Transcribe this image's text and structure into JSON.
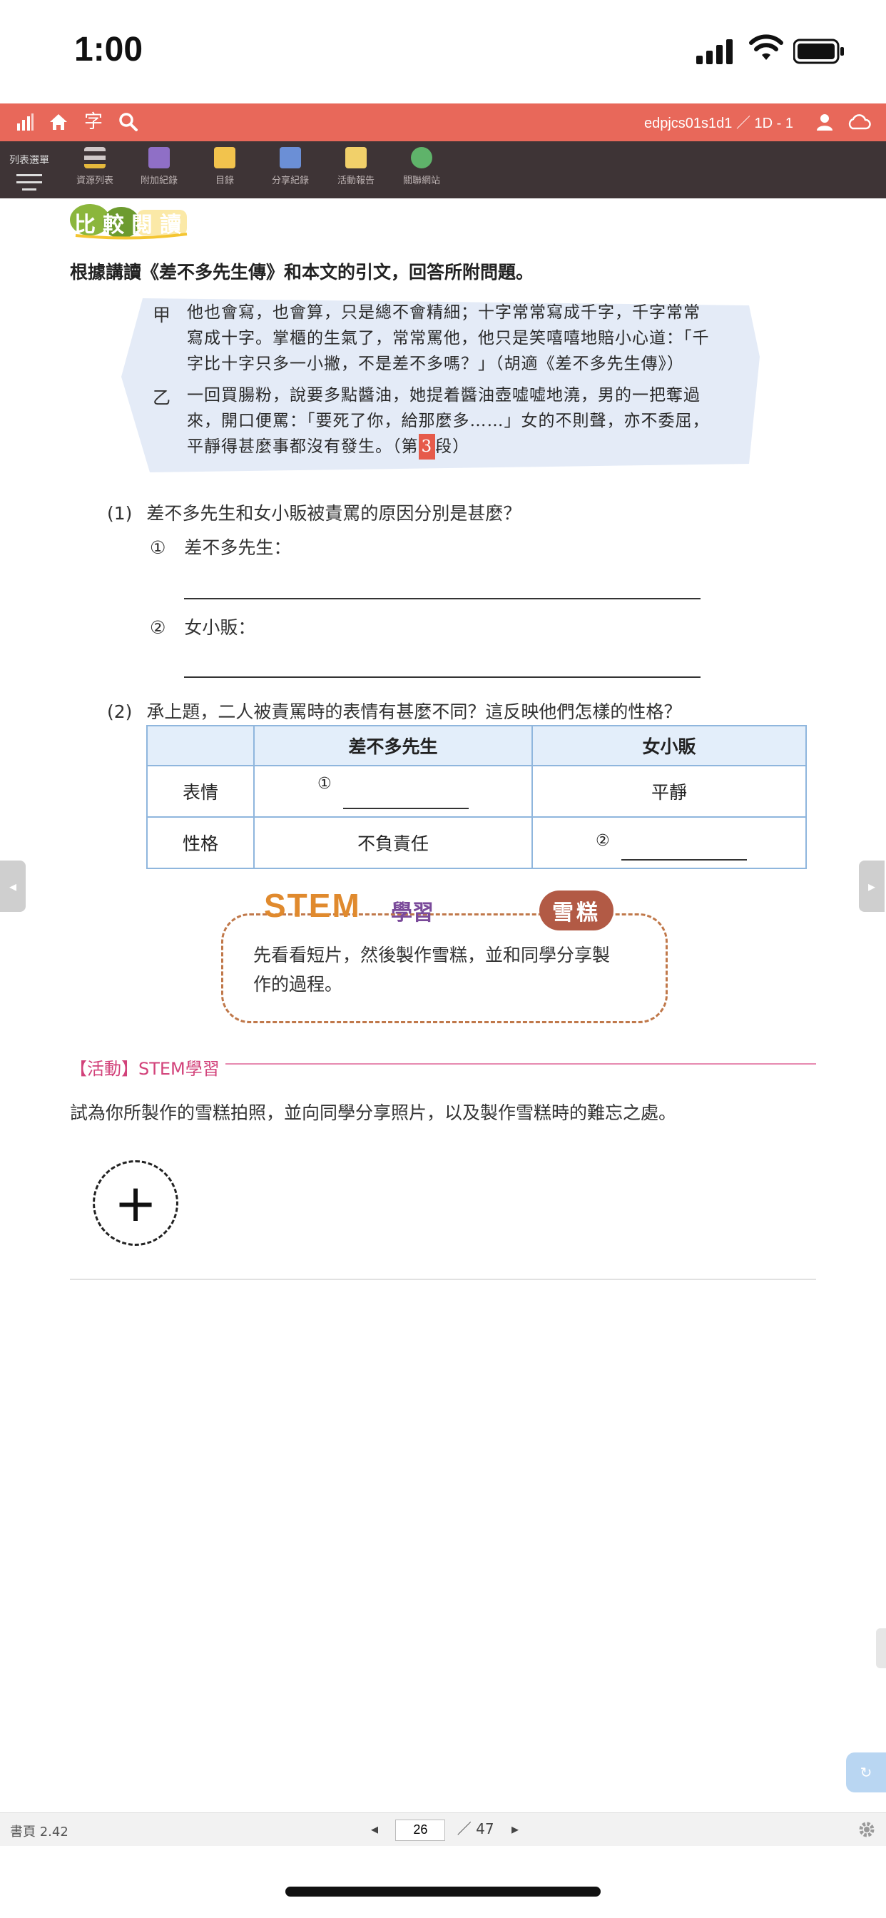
{
  "status_bar": {
    "time": "1:00"
  },
  "top_bar": {
    "font_button": "字",
    "account": "edpjcs01s1d1 ／ 1D - 1"
  },
  "toolbar": {
    "list_menu_label": "列表選單",
    "items": [
      {
        "label": "資源列表",
        "icon": "resource-list-icon"
      },
      {
        "label": "附加紀錄",
        "icon": "attachment-record-icon"
      },
      {
        "label": "目錄",
        "icon": "contents-icon"
      },
      {
        "label": "分享紀錄",
        "icon": "share-record-icon"
      },
      {
        "label": "活動報告",
        "icon": "activity-report-icon"
      },
      {
        "label": "關聯網站",
        "icon": "related-website-icon"
      }
    ]
  },
  "content": {
    "banner": "比較閱讀",
    "instruction": "根據講讀《差不多先生傳》和本文的引文，回答所附問題。",
    "quote_a_label": "甲",
    "quote_a_lines": [
      "他也會寫，也會算，只是總不會精細；十字常常寫成千字，千字常常",
      "寫成十字。掌櫃的生氣了，常常罵他，他只是笑嘻嘻地賠小心道：「千",
      "字比十字只多一小撇，不是差不多嗎？」（胡適《差不多先生傳》）"
    ],
    "quote_b_label": "乙",
    "quote_b_lines": [
      "一回買腸粉，說要多點醬油，她提着醬油壺嘘嘘地澆，男的一把奪過",
      "來，開口便罵：「要死了你，給那麼多……」女的不則聲，亦不委屈，"
    ],
    "quote_b_last_pre": "平靜得甚麼事都沒有發生。（第",
    "quote_b_para": "3",
    "quote_b_last_post": "段）",
    "q1_num": "(1)",
    "q1_text": "差不多先生和女小販被責罵的原因分別是甚麼？",
    "q1_a_num": "①",
    "q1_a_label": "差不多先生：",
    "q1_b_num": "②",
    "q1_b_label": "女小販：",
    "q2_num": "(2)",
    "q2_text": "承上題，二人被責罵時的表情有甚麼不同？這反映他們怎樣的性格？",
    "table": {
      "headers": [
        "",
        "差不多先生",
        "女小販"
      ],
      "row1_label": "表情",
      "row1_left_num": "①",
      "row1_right": "平靜",
      "row2_label": "性格",
      "row2_left": "不負責任",
      "row2_right_num": "②"
    },
    "stem": {
      "title_en": "STEM",
      "title_zh": "學習",
      "tag": "雪糕",
      "text_line1": "先看看短片，然後製作雪糕，並和同學分享製",
      "text_line2": "作的過程。"
    },
    "activity_label": "【活動】STEM學習",
    "activity_text": "試為你所製作的雪糕拍照，並向同學分享照片，以及製作雪糕時的難忘之處。",
    "add_button": "+"
  },
  "bottom_bar": {
    "page_info": "書頁 2.42",
    "prev": "◂",
    "page_current": "26",
    "page_total": "／ 47",
    "next": "▸"
  },
  "side_nav": {
    "left": "◂",
    "right": "▸"
  },
  "colors": {
    "top_bar": "#e8685a",
    "toolbar": "#3e3436",
    "table_border": "#8fb6dd",
    "activity": "#d2427a"
  }
}
